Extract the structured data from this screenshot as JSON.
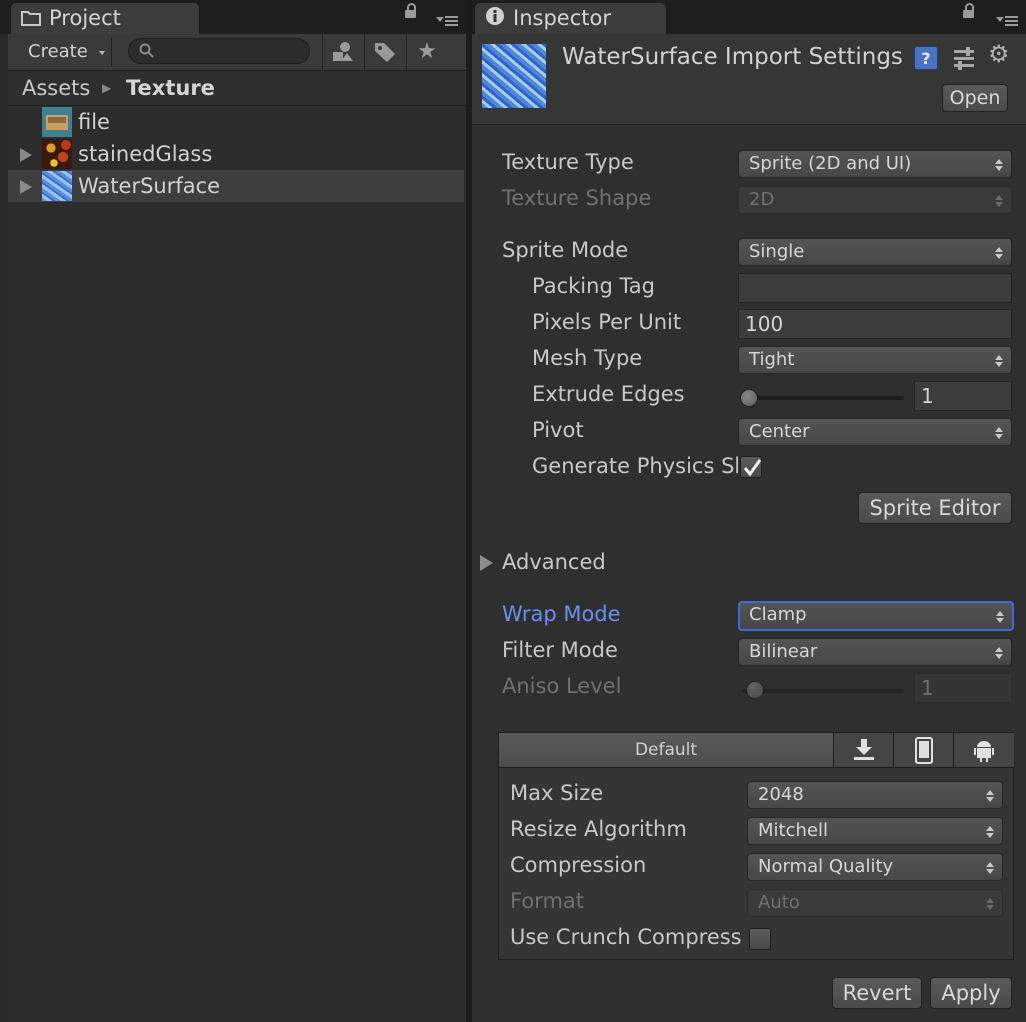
{
  "project": {
    "tab_title": "Project",
    "create_label": "Create",
    "search": {
      "value": "",
      "placeholder": ""
    },
    "breadcrumb": {
      "root": "Assets",
      "current": "Texture"
    },
    "assets": [
      {
        "name": "file",
        "expandable": false,
        "selected": false,
        "thumb": "folder-image"
      },
      {
        "name": "stainedGlass",
        "expandable": true,
        "selected": false,
        "thumb": "stained-glass"
      },
      {
        "name": "WaterSurface",
        "expandable": true,
        "selected": true,
        "thumb": "water"
      }
    ]
  },
  "inspector": {
    "tab_title": "Inspector",
    "header_title": "WaterSurface Import Settings",
    "open_label": "Open",
    "texture_type": {
      "label": "Texture Type",
      "value": "Sprite (2D and UI)"
    },
    "texture_shape": {
      "label": "Texture Shape",
      "value": "2D"
    },
    "sprite_mode": {
      "label": "Sprite Mode",
      "value": "Single"
    },
    "packing_tag": {
      "label": "Packing Tag",
      "value": ""
    },
    "pixels_per_unit": {
      "label": "Pixels Per Unit",
      "value": "100"
    },
    "mesh_type": {
      "label": "Mesh Type",
      "value": "Tight"
    },
    "extrude_edges": {
      "label": "Extrude Edges",
      "value": "1"
    },
    "pivot": {
      "label": "Pivot",
      "value": "Center"
    },
    "generate_physics": {
      "label": "Generate Physics Sh",
      "checked": true
    },
    "sprite_editor_label": "Sprite Editor",
    "advanced_label": "Advanced",
    "wrap_mode": {
      "label": "Wrap Mode",
      "value": "Clamp"
    },
    "filter_mode": {
      "label": "Filter Mode",
      "value": "Bilinear"
    },
    "aniso_level": {
      "label": "Aniso Level",
      "value": "1"
    },
    "platform": {
      "default_tab": "Default",
      "icons": [
        "download-icon",
        "phone-icon",
        "android-icon"
      ],
      "max_size": {
        "label": "Max Size",
        "value": "2048"
      },
      "resize_algorithm": {
        "label": "Resize Algorithm",
        "value": "Mitchell"
      },
      "compression": {
        "label": "Compression",
        "value": "Normal Quality"
      },
      "format": {
        "label": "Format",
        "value": "Auto"
      },
      "use_crunch": {
        "label": "Use Crunch Compress",
        "checked": false
      }
    },
    "revert_label": "Revert",
    "apply_label": "Apply"
  },
  "colors": {
    "accent": "#3b6bdc",
    "label_focus": "#6b8ff0",
    "panel_bg": "#2f2f2f"
  }
}
